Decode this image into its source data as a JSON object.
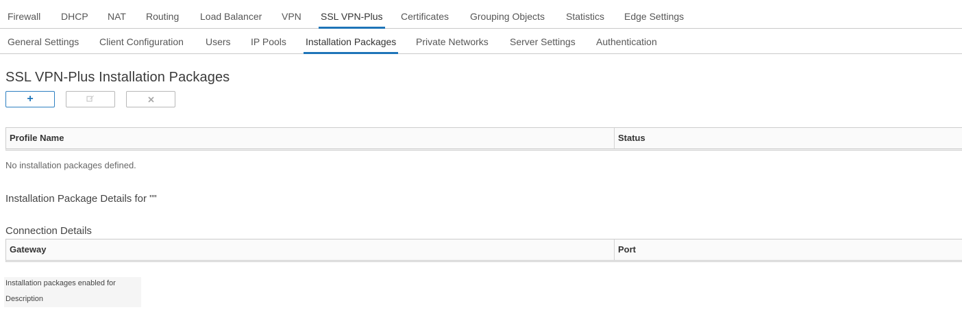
{
  "primary_tabs": [
    {
      "label": "Firewall",
      "active": false
    },
    {
      "label": "DHCP",
      "active": false
    },
    {
      "label": "NAT",
      "active": false
    },
    {
      "label": "Routing",
      "active": false
    },
    {
      "label": "Load Balancer",
      "active": false
    },
    {
      "label": "VPN",
      "active": false
    },
    {
      "label": "SSL VPN-Plus",
      "active": true
    },
    {
      "label": "Certificates",
      "active": false
    },
    {
      "label": "Grouping Objects",
      "active": false
    },
    {
      "label": "Statistics",
      "active": false
    },
    {
      "label": "Edge Settings",
      "active": false
    }
  ],
  "secondary_tabs": [
    {
      "label": "General Settings",
      "active": false
    },
    {
      "label": "Client Configuration",
      "active": false
    },
    {
      "label": "Users",
      "active": false
    },
    {
      "label": "IP Pools",
      "active": false
    },
    {
      "label": "Installation Packages",
      "active": true
    },
    {
      "label": "Private Networks",
      "active": false
    },
    {
      "label": "Server Settings",
      "active": false
    },
    {
      "label": "Authentication",
      "active": false
    }
  ],
  "page_title": "SSL VPN-Plus Installation Packages",
  "toolbar": {
    "add_icon": "plus-icon",
    "edit_icon": "edit-icon",
    "delete_icon": "close-icon"
  },
  "packages_table": {
    "columns": [
      "Profile Name",
      "Status"
    ],
    "empty_message": "No installation packages defined."
  },
  "details_title": "Installation Package Details for \"\"",
  "connection_details": {
    "title": "Connection Details",
    "columns": [
      "Gateway",
      "Port"
    ]
  },
  "footer": {
    "enabled_for_label": "Installation packages enabled for",
    "description_label": "Description"
  },
  "colors": {
    "accent": "#1e74b8"
  }
}
